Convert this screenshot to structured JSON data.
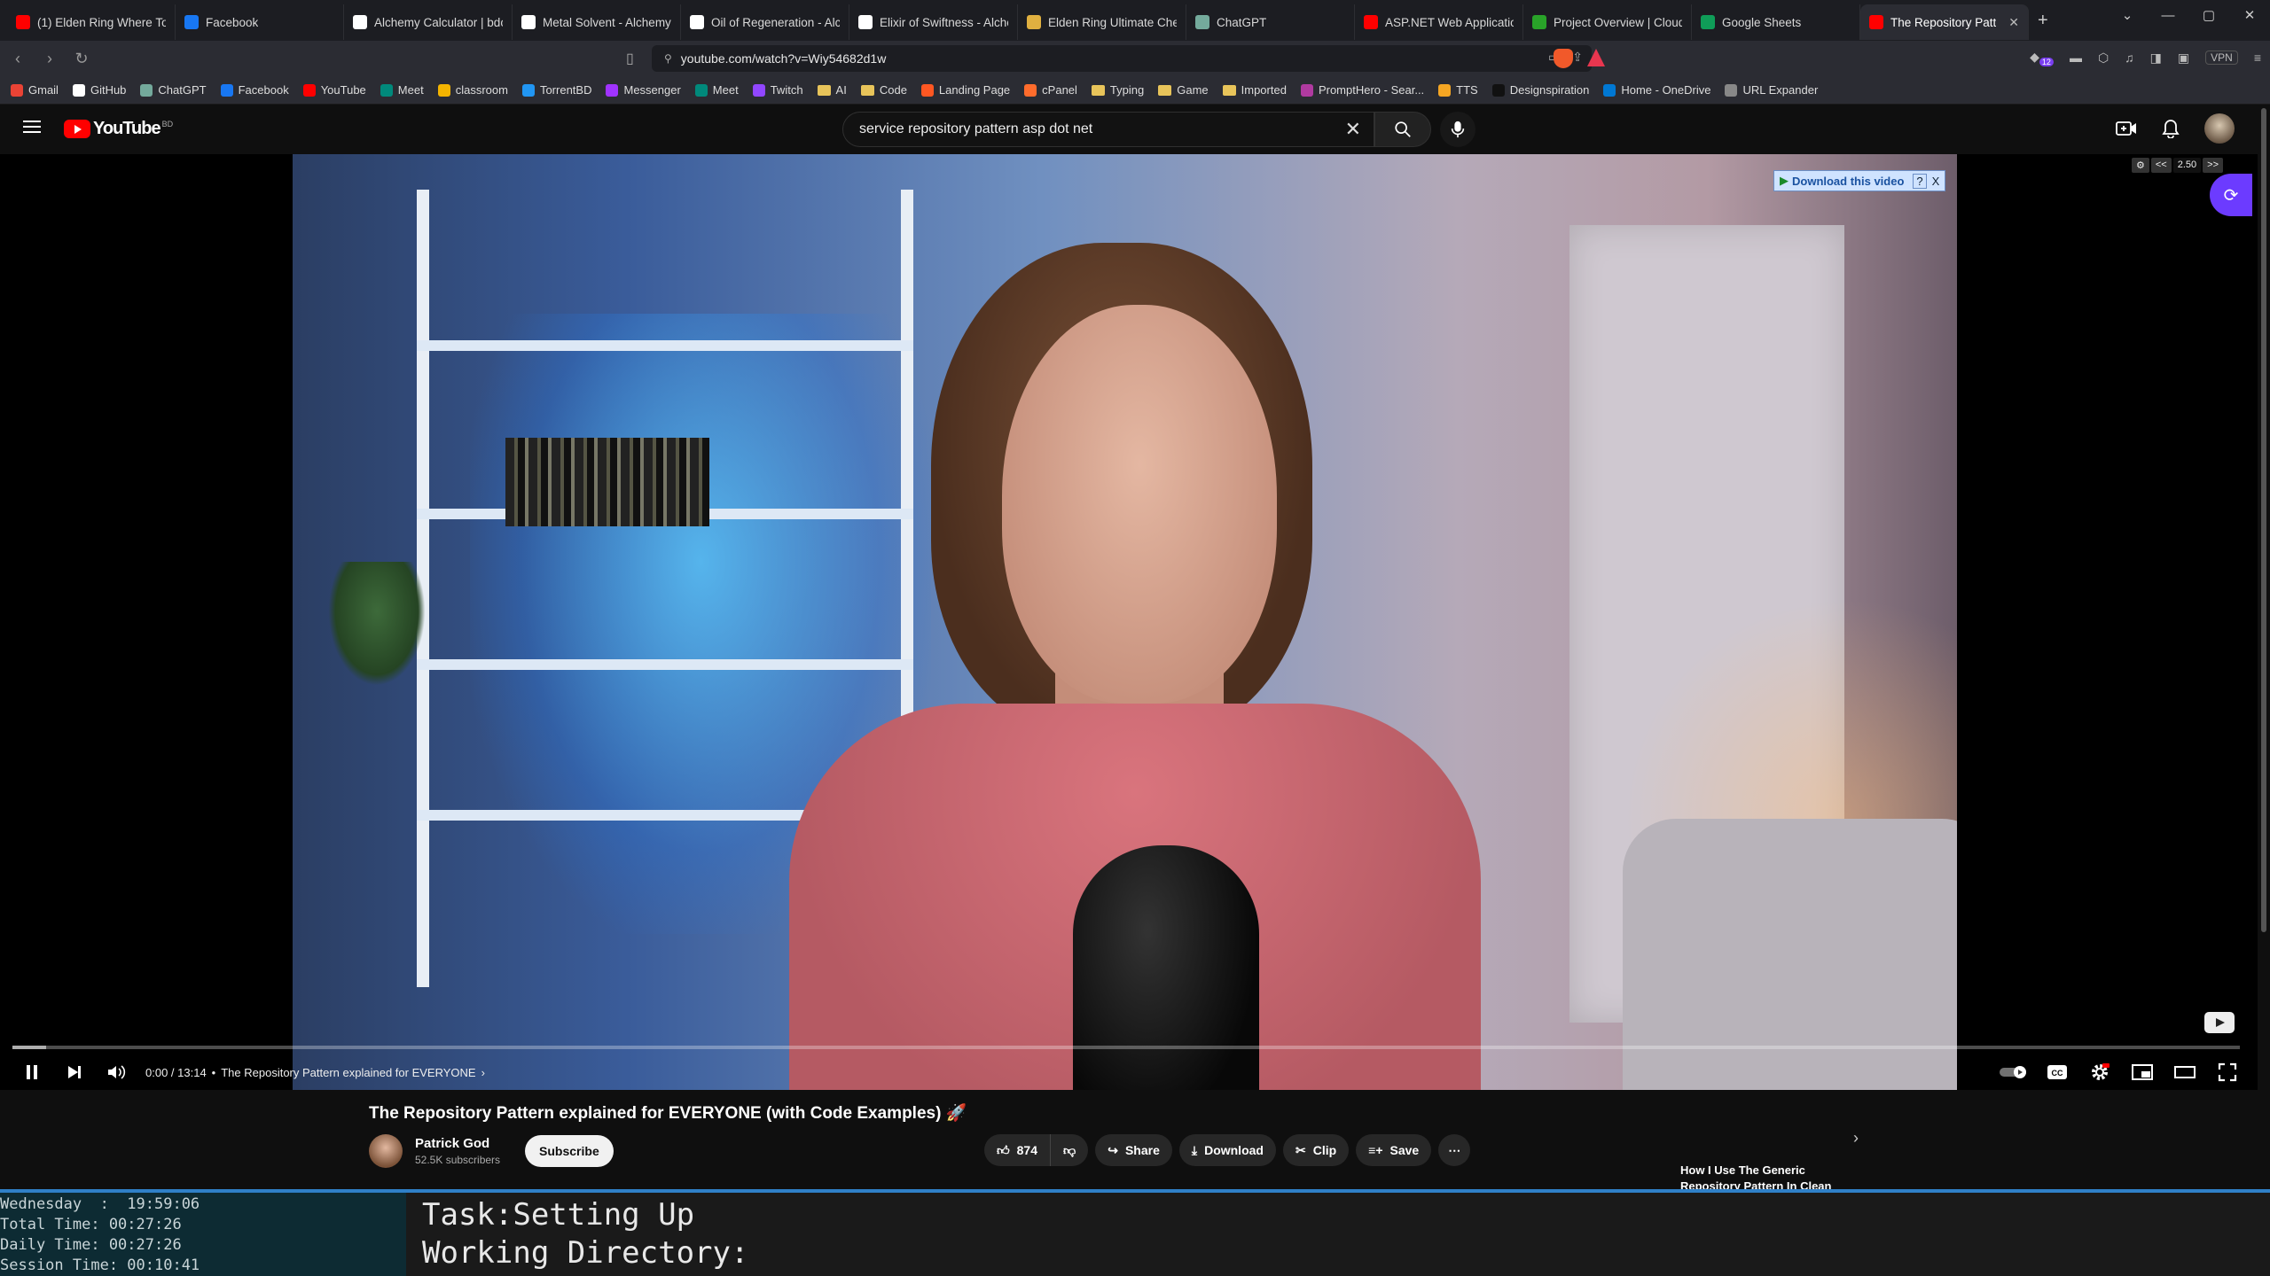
{
  "tabs": [
    {
      "title": "(1) Elden Ring Where To Go",
      "icon": "youtube-icon",
      "color": "#ff0000"
    },
    {
      "title": "Facebook",
      "icon": "facebook-icon",
      "color": "#1877f2"
    },
    {
      "title": "Alchemy Calculator | bdolyt",
      "icon": "alchemy-icon",
      "color": "#ffffff"
    },
    {
      "title": "Metal Solvent - Alchemy Ca",
      "icon": "alchemy-icon",
      "color": "#ffffff"
    },
    {
      "title": "Oil of Regeneration - Alche",
      "icon": "alchemy-icon",
      "color": "#ffffff"
    },
    {
      "title": "Elixir of Swiftness - Alchem",
      "icon": "alchemy-icon",
      "color": "#ffffff"
    },
    {
      "title": "Elden Ring Ultimate Cheat S",
      "icon": "elden-icon",
      "color": "#e0b040"
    },
    {
      "title": "ChatGPT",
      "icon": "chatgpt-icon",
      "color": "#74aa9c"
    },
    {
      "title": "ASP.NET Web Application T",
      "icon": "youtube-icon",
      "color": "#ff0000"
    },
    {
      "title": "Project Overview | Cloud: M",
      "icon": "cloud-icon",
      "color": "#29a329"
    },
    {
      "title": "Google Sheets",
      "icon": "sheets-icon",
      "color": "#0f9d58"
    },
    {
      "title": "The Repository Patt",
      "icon": "youtube-icon",
      "color": "#ff0000",
      "active": true
    }
  ],
  "address": {
    "url": "youtube.com/watch?v=Wiy54682d1w"
  },
  "extensions": {
    "brave_badge": "",
    "notif_badge": "12",
    "vpn": "VPN"
  },
  "bookmarks": [
    {
      "label": "Gmail",
      "type": "site",
      "color": "#ea4335"
    },
    {
      "label": "GitHub",
      "type": "site",
      "color": "#ffffff"
    },
    {
      "label": "ChatGPT",
      "type": "site",
      "color": "#74aa9c"
    },
    {
      "label": "Facebook",
      "type": "site",
      "color": "#1877f2"
    },
    {
      "label": "YouTube",
      "type": "site",
      "color": "#ff0000"
    },
    {
      "label": "Meet",
      "type": "site",
      "color": "#00897b"
    },
    {
      "label": "classroom",
      "type": "site",
      "color": "#f4b400"
    },
    {
      "label": "TorrentBD",
      "type": "site",
      "color": "#2196f3"
    },
    {
      "label": "Messenger",
      "type": "site",
      "color": "#a033ff"
    },
    {
      "label": "Meet",
      "type": "site",
      "color": "#00897b"
    },
    {
      "label": "Twitch",
      "type": "site",
      "color": "#9146ff"
    },
    {
      "label": "AI",
      "type": "folder"
    },
    {
      "label": "Code",
      "type": "folder"
    },
    {
      "label": "Landing Page",
      "type": "site",
      "color": "#ff5722"
    },
    {
      "label": "cPanel",
      "type": "site",
      "color": "#ff6c2c"
    },
    {
      "label": "Typing",
      "type": "folder"
    },
    {
      "label": "Game",
      "type": "folder"
    },
    {
      "label": "Imported",
      "type": "folder"
    },
    {
      "label": "PromptHero - Sear...",
      "type": "site",
      "color": "#b03aa0"
    },
    {
      "label": "TTS",
      "type": "site",
      "color": "#f5a623"
    },
    {
      "label": "Designspiration",
      "type": "site",
      "color": "#111111"
    },
    {
      "label": "Home - OneDrive",
      "type": "site",
      "color": "#0078d4"
    },
    {
      "label": "URL Expander",
      "type": "site",
      "color": "#888888"
    }
  ],
  "youtube": {
    "logo": "YouTube",
    "country": "BD",
    "search": {
      "value": "service repository pattern asp dot net"
    }
  },
  "player": {
    "download_banner": "Download this video",
    "download_help": "?",
    "download_close": "X",
    "speed": {
      "down": "<<",
      "value": "2.50",
      "up": ">>"
    },
    "time": "0:00 / 13:14",
    "chapter": "The Repository Pattern explained for EVERYONE",
    "progress": 0.0,
    "buffered": 0.015
  },
  "video": {
    "title": "The Repository Pattern explained for EVERYONE (with Code Examples) 🚀",
    "channel": "Patrick God",
    "subscribers": "52.5K subscribers",
    "subscribe_label": "Subscribe",
    "likes": "874",
    "share_label": "Share",
    "download_label": "Download",
    "clip_label": "Clip",
    "save_label": "Save"
  },
  "recommendation": {
    "title": "How I Use The Generic Repository Pattern In Clean"
  },
  "terminal": {
    "day_line": "Wednesday  :  19:59:06",
    "total_line": "Total Time: 00:27:26",
    "daily_line": "Daily Time: 00:27:26",
    "session_line": "Session Time: 00:10:41",
    "task": "Task:Setting Up",
    "directory": "Working Directory:"
  }
}
